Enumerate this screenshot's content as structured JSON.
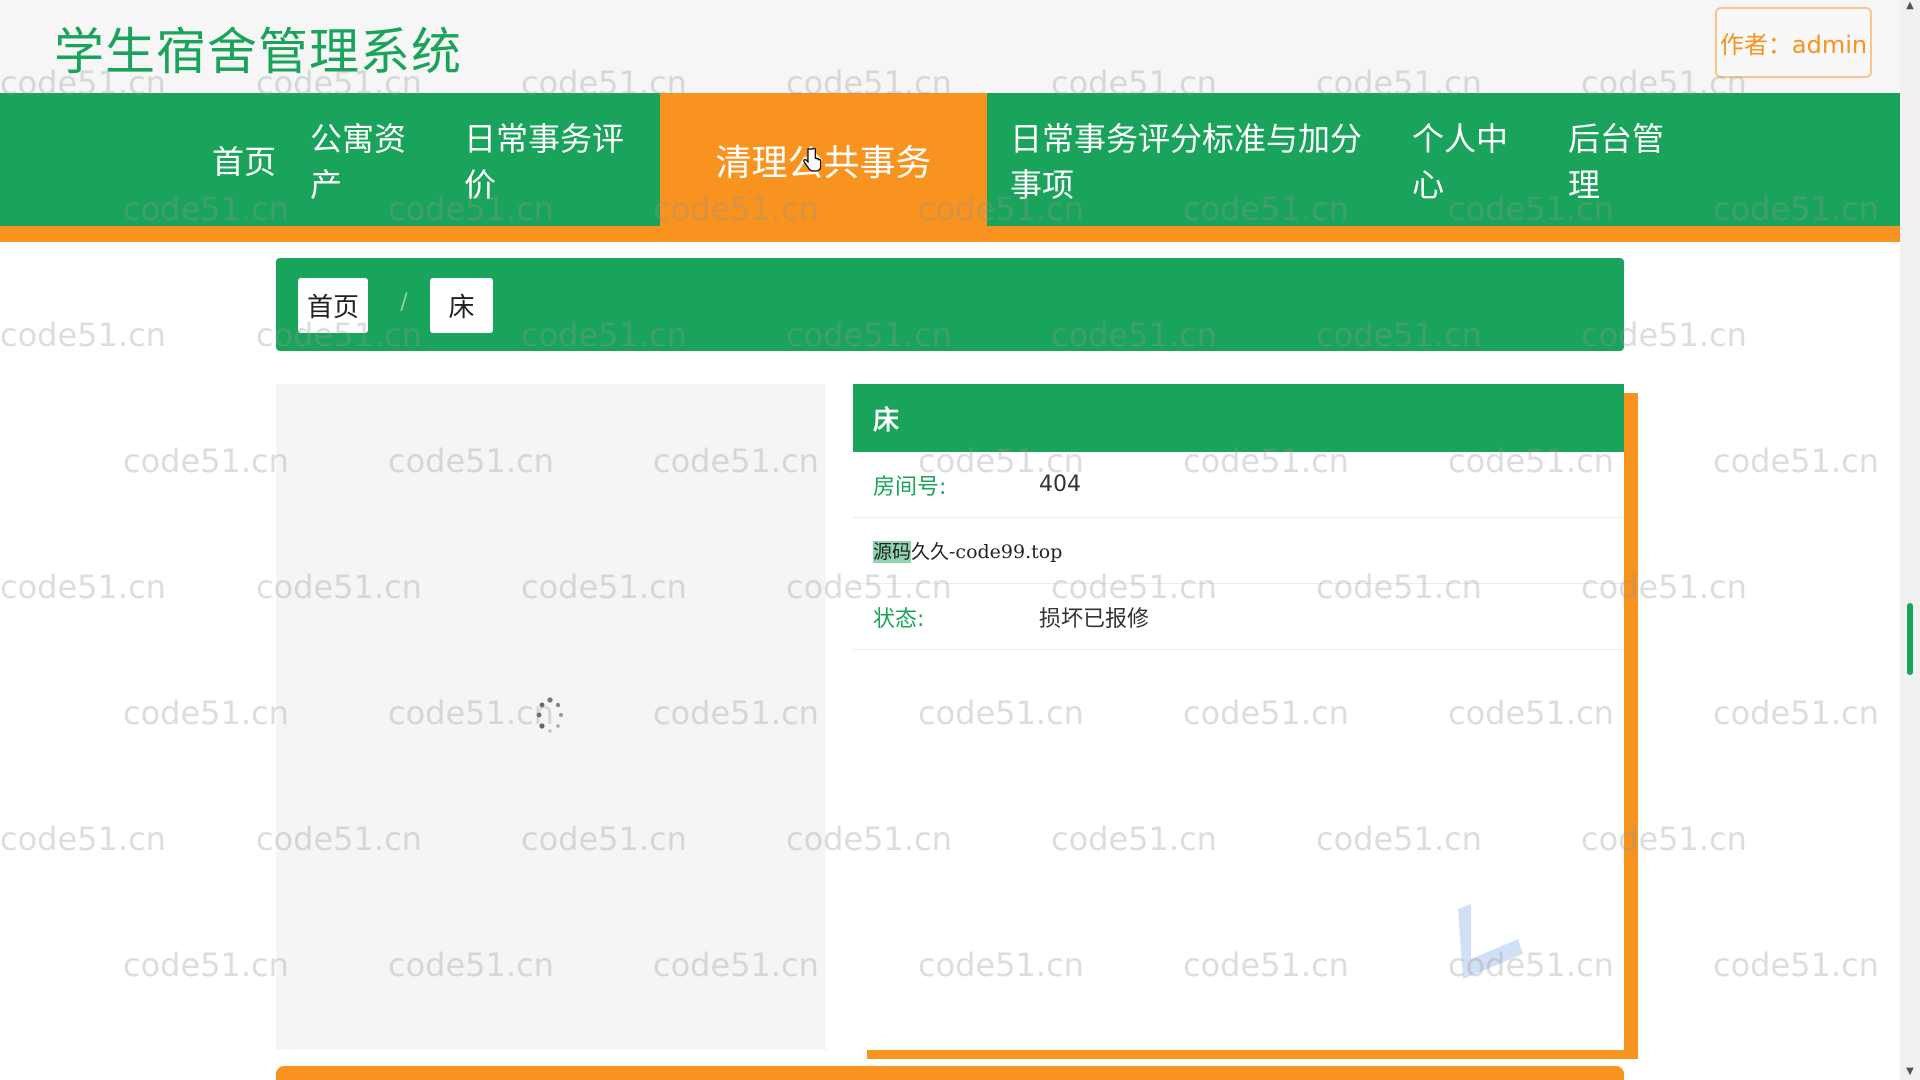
{
  "header": {
    "site_title": "学生宿舍管理系统",
    "author_label": "作者：admin"
  },
  "nav": {
    "items": [
      {
        "label": "首页"
      },
      {
        "label": "公寓资产"
      },
      {
        "label": "日常事务评价"
      },
      {
        "label": "清理公共事务",
        "active": true
      },
      {
        "label": "日常事务评分标准与加分事项"
      },
      {
        "label": "个人中心"
      },
      {
        "label": "后台管理"
      }
    ]
  },
  "breadcrumb": {
    "home": "首页",
    "separator": "/",
    "current": "床"
  },
  "detail": {
    "title": "床",
    "room_label": "房间号:",
    "room_value": "404",
    "overlay_highlight": "源码",
    "overlay_rest": "久久-code99.top",
    "status_label": "状态:",
    "status_value": "损坏已报修"
  },
  "watermark": "code51.cn",
  "colors": {
    "primary_green": "#1aa35a",
    "accent_orange": "#f7931e"
  }
}
